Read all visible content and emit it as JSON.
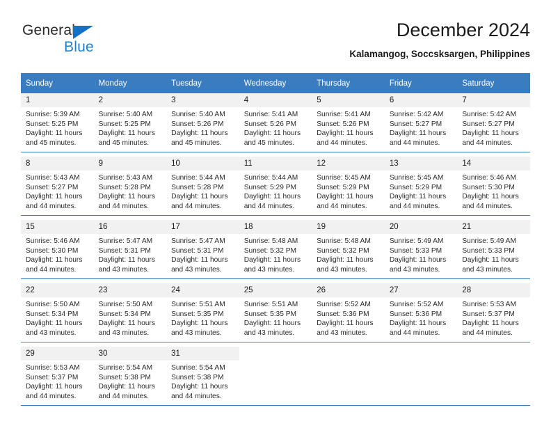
{
  "brand": {
    "name_part1": "General",
    "name_part2": "Blue",
    "primary_color": "#1b7fd4",
    "triangle_color": "#1471c4"
  },
  "header": {
    "title": "December 2024",
    "subtitle": "Kalamangog, Soccsksargen, Philippines"
  },
  "calendar": {
    "header_bg": "#3a7cc0",
    "daynum_bg": "#f1f1f1",
    "weekdays": [
      "Sunday",
      "Monday",
      "Tuesday",
      "Wednesday",
      "Thursday",
      "Friday",
      "Saturday"
    ],
    "weeks": [
      {
        "days": [
          {
            "num": "1",
            "sunrise": "Sunrise: 5:39 AM",
            "sunset": "Sunset: 5:25 PM",
            "daylight1": "Daylight: 11 hours",
            "daylight2": "and 45 minutes."
          },
          {
            "num": "2",
            "sunrise": "Sunrise: 5:40 AM",
            "sunset": "Sunset: 5:25 PM",
            "daylight1": "Daylight: 11 hours",
            "daylight2": "and 45 minutes."
          },
          {
            "num": "3",
            "sunrise": "Sunrise: 5:40 AM",
            "sunset": "Sunset: 5:26 PM",
            "daylight1": "Daylight: 11 hours",
            "daylight2": "and 45 minutes."
          },
          {
            "num": "4",
            "sunrise": "Sunrise: 5:41 AM",
            "sunset": "Sunset: 5:26 PM",
            "daylight1": "Daylight: 11 hours",
            "daylight2": "and 45 minutes."
          },
          {
            "num": "5",
            "sunrise": "Sunrise: 5:41 AM",
            "sunset": "Sunset: 5:26 PM",
            "daylight1": "Daylight: 11 hours",
            "daylight2": "and 44 minutes."
          },
          {
            "num": "6",
            "sunrise": "Sunrise: 5:42 AM",
            "sunset": "Sunset: 5:27 PM",
            "daylight1": "Daylight: 11 hours",
            "daylight2": "and 44 minutes."
          },
          {
            "num": "7",
            "sunrise": "Sunrise: 5:42 AM",
            "sunset": "Sunset: 5:27 PM",
            "daylight1": "Daylight: 11 hours",
            "daylight2": "and 44 minutes."
          }
        ]
      },
      {
        "days": [
          {
            "num": "8",
            "sunrise": "Sunrise: 5:43 AM",
            "sunset": "Sunset: 5:27 PM",
            "daylight1": "Daylight: 11 hours",
            "daylight2": "and 44 minutes."
          },
          {
            "num": "9",
            "sunrise": "Sunrise: 5:43 AM",
            "sunset": "Sunset: 5:28 PM",
            "daylight1": "Daylight: 11 hours",
            "daylight2": "and 44 minutes."
          },
          {
            "num": "10",
            "sunrise": "Sunrise: 5:44 AM",
            "sunset": "Sunset: 5:28 PM",
            "daylight1": "Daylight: 11 hours",
            "daylight2": "and 44 minutes."
          },
          {
            "num": "11",
            "sunrise": "Sunrise: 5:44 AM",
            "sunset": "Sunset: 5:29 PM",
            "daylight1": "Daylight: 11 hours",
            "daylight2": "and 44 minutes."
          },
          {
            "num": "12",
            "sunrise": "Sunrise: 5:45 AM",
            "sunset": "Sunset: 5:29 PM",
            "daylight1": "Daylight: 11 hours",
            "daylight2": "and 44 minutes."
          },
          {
            "num": "13",
            "sunrise": "Sunrise: 5:45 AM",
            "sunset": "Sunset: 5:29 PM",
            "daylight1": "Daylight: 11 hours",
            "daylight2": "and 44 minutes."
          },
          {
            "num": "14",
            "sunrise": "Sunrise: 5:46 AM",
            "sunset": "Sunset: 5:30 PM",
            "daylight1": "Daylight: 11 hours",
            "daylight2": "and 44 minutes."
          }
        ]
      },
      {
        "days": [
          {
            "num": "15",
            "sunrise": "Sunrise: 5:46 AM",
            "sunset": "Sunset: 5:30 PM",
            "daylight1": "Daylight: 11 hours",
            "daylight2": "and 44 minutes."
          },
          {
            "num": "16",
            "sunrise": "Sunrise: 5:47 AM",
            "sunset": "Sunset: 5:31 PM",
            "daylight1": "Daylight: 11 hours",
            "daylight2": "and 43 minutes."
          },
          {
            "num": "17",
            "sunrise": "Sunrise: 5:47 AM",
            "sunset": "Sunset: 5:31 PM",
            "daylight1": "Daylight: 11 hours",
            "daylight2": "and 43 minutes."
          },
          {
            "num": "18",
            "sunrise": "Sunrise: 5:48 AM",
            "sunset": "Sunset: 5:32 PM",
            "daylight1": "Daylight: 11 hours",
            "daylight2": "and 43 minutes."
          },
          {
            "num": "19",
            "sunrise": "Sunrise: 5:48 AM",
            "sunset": "Sunset: 5:32 PM",
            "daylight1": "Daylight: 11 hours",
            "daylight2": "and 43 minutes."
          },
          {
            "num": "20",
            "sunrise": "Sunrise: 5:49 AM",
            "sunset": "Sunset: 5:33 PM",
            "daylight1": "Daylight: 11 hours",
            "daylight2": "and 43 minutes."
          },
          {
            "num": "21",
            "sunrise": "Sunrise: 5:49 AM",
            "sunset": "Sunset: 5:33 PM",
            "daylight1": "Daylight: 11 hours",
            "daylight2": "and 43 minutes."
          }
        ]
      },
      {
        "days": [
          {
            "num": "22",
            "sunrise": "Sunrise: 5:50 AM",
            "sunset": "Sunset: 5:34 PM",
            "daylight1": "Daylight: 11 hours",
            "daylight2": "and 43 minutes."
          },
          {
            "num": "23",
            "sunrise": "Sunrise: 5:50 AM",
            "sunset": "Sunset: 5:34 PM",
            "daylight1": "Daylight: 11 hours",
            "daylight2": "and 43 minutes."
          },
          {
            "num": "24",
            "sunrise": "Sunrise: 5:51 AM",
            "sunset": "Sunset: 5:35 PM",
            "daylight1": "Daylight: 11 hours",
            "daylight2": "and 43 minutes."
          },
          {
            "num": "25",
            "sunrise": "Sunrise: 5:51 AM",
            "sunset": "Sunset: 5:35 PM",
            "daylight1": "Daylight: 11 hours",
            "daylight2": "and 43 minutes."
          },
          {
            "num": "26",
            "sunrise": "Sunrise: 5:52 AM",
            "sunset": "Sunset: 5:36 PM",
            "daylight1": "Daylight: 11 hours",
            "daylight2": "and 43 minutes."
          },
          {
            "num": "27",
            "sunrise": "Sunrise: 5:52 AM",
            "sunset": "Sunset: 5:36 PM",
            "daylight1": "Daylight: 11 hours",
            "daylight2": "and 44 minutes."
          },
          {
            "num": "28",
            "sunrise": "Sunrise: 5:53 AM",
            "sunset": "Sunset: 5:37 PM",
            "daylight1": "Daylight: 11 hours",
            "daylight2": "and 44 minutes."
          }
        ]
      },
      {
        "days": [
          {
            "num": "29",
            "sunrise": "Sunrise: 5:53 AM",
            "sunset": "Sunset: 5:37 PM",
            "daylight1": "Daylight: 11 hours",
            "daylight2": "and 44 minutes."
          },
          {
            "num": "30",
            "sunrise": "Sunrise: 5:54 AM",
            "sunset": "Sunset: 5:38 PM",
            "daylight1": "Daylight: 11 hours",
            "daylight2": "and 44 minutes."
          },
          {
            "num": "31",
            "sunrise": "Sunrise: 5:54 AM",
            "sunset": "Sunset: 5:38 PM",
            "daylight1": "Daylight: 11 hours",
            "daylight2": "and 44 minutes."
          },
          {
            "num": "",
            "sunrise": "",
            "sunset": "",
            "daylight1": "",
            "daylight2": ""
          },
          {
            "num": "",
            "sunrise": "",
            "sunset": "",
            "daylight1": "",
            "daylight2": ""
          },
          {
            "num": "",
            "sunrise": "",
            "sunset": "",
            "daylight1": "",
            "daylight2": ""
          },
          {
            "num": "",
            "sunrise": "",
            "sunset": "",
            "daylight1": "",
            "daylight2": ""
          }
        ]
      }
    ]
  }
}
